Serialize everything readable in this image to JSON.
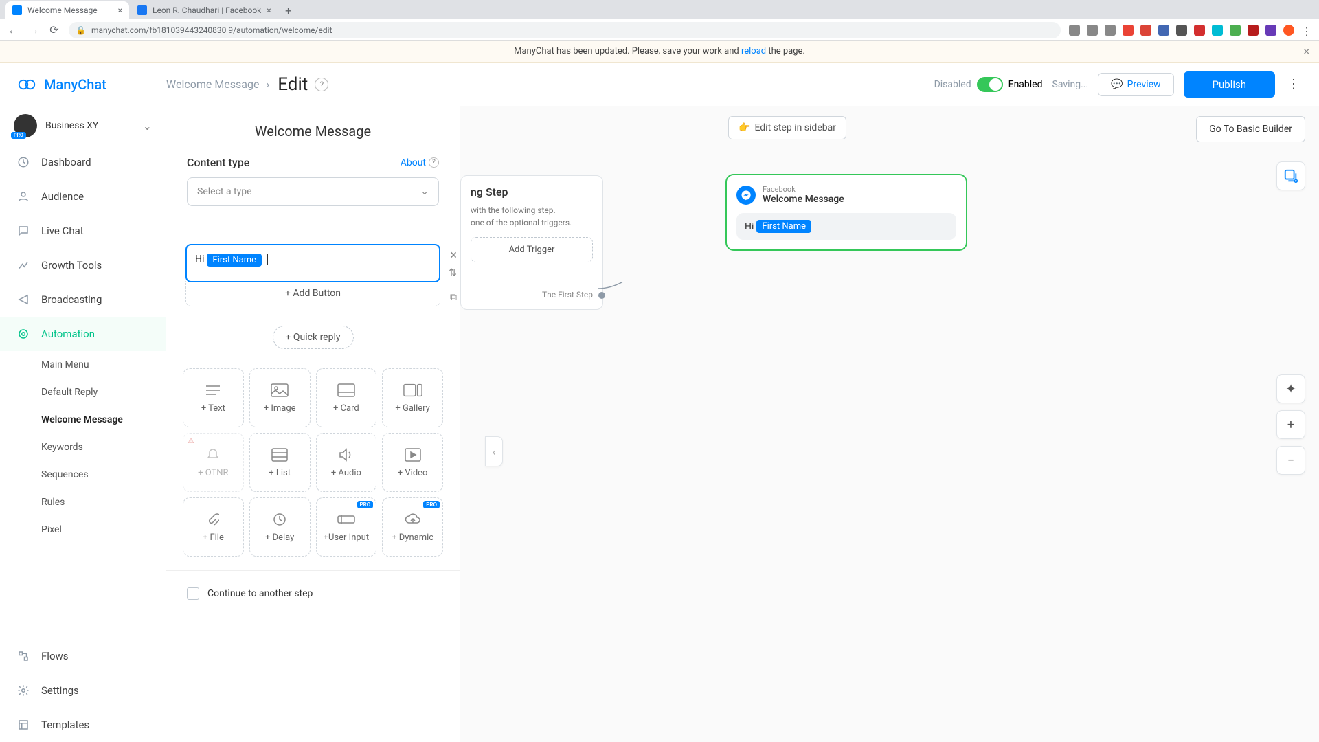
{
  "browser": {
    "tabs": [
      {
        "title": "Welcome Message",
        "favicon": "#0084ff"
      },
      {
        "title": "Leon R. Chaudhari | Facebook",
        "favicon": "#1877f2"
      }
    ],
    "url": "manychat.com/fb181039443240830 9/automation/welcome/edit"
  },
  "banner": {
    "text_before": "ManyChat has been updated. Please, save your work and ",
    "link": "reload",
    "text_after": " the page."
  },
  "brand": "ManyChat",
  "breadcrumb": {
    "parent": "Welcome Message",
    "current": "Edit"
  },
  "topbar": {
    "disabled": "Disabled",
    "enabled": "Enabled",
    "saving": "Saving...",
    "preview": "Preview",
    "publish": "Publish"
  },
  "workspace": {
    "name": "Business XY",
    "pro": "PRO"
  },
  "nav": {
    "dashboard": "Dashboard",
    "audience": "Audience",
    "livechat": "Live Chat",
    "growth": "Growth Tools",
    "broadcasting": "Broadcasting",
    "automation": "Automation",
    "flows": "Flows",
    "settings": "Settings",
    "templates": "Templates"
  },
  "subnav": {
    "main_menu": "Main Menu",
    "default_reply": "Default Reply",
    "welcome_message": "Welcome Message",
    "keywords": "Keywords",
    "sequences": "Sequences",
    "rules": "Rules",
    "pixel": "Pixel"
  },
  "editor": {
    "title": "Welcome Message",
    "content_type": "Content type",
    "about": "About",
    "select_placeholder": "Select a type",
    "msg_prefix": "Hi",
    "var_name": "First Name",
    "add_button": "+ Add Button",
    "quick_reply": "+ Quick reply",
    "continue": "Continue to another step"
  },
  "blocks": {
    "text": "+ Text",
    "image": "+ Image",
    "card": "+ Card",
    "gallery": "+ Gallery",
    "otnr": "+ OTNR",
    "list": "+ List",
    "audio": "+ Audio",
    "video": "+ Video",
    "file": "+ File",
    "delay": "+ Delay",
    "user_input": "+User Input",
    "dynamic": "+ Dynamic"
  },
  "canvas": {
    "edit_sidebar": "Edit step in sidebar",
    "go_basic": "Go To Basic Builder",
    "starting_title": "ng Step",
    "starting_desc1": "with the following step.",
    "starting_desc2": "one of the optional triggers.",
    "add_trigger": "Add Trigger",
    "first_step": "The First Step",
    "preview_platform": "Facebook",
    "preview_title": "Welcome Message",
    "preview_msg_prefix": "Hi",
    "preview_var": "First Name"
  }
}
